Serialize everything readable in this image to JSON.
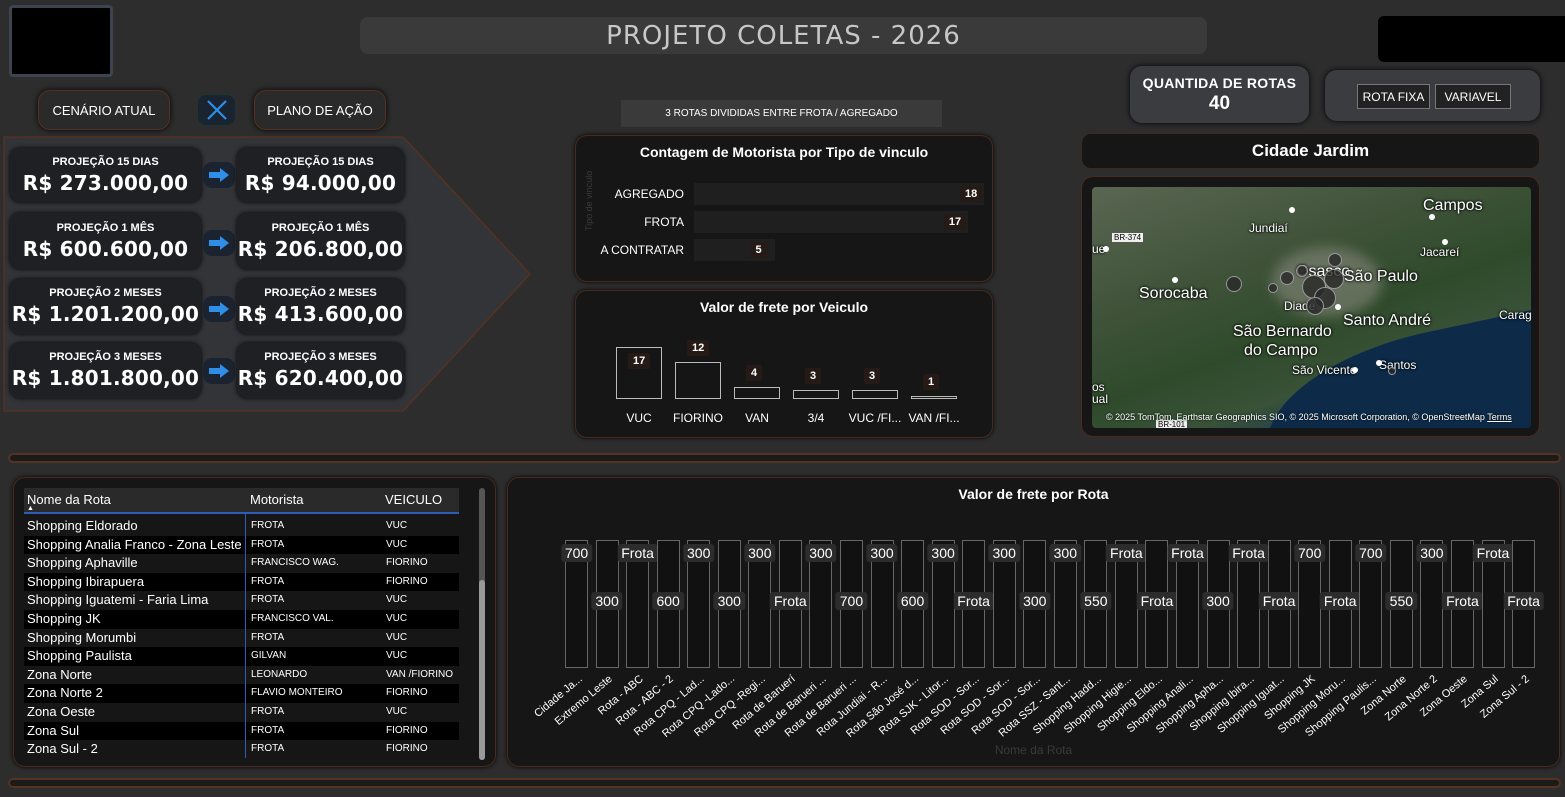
{
  "header": {
    "title": "PROJETO COLETAS - 2026",
    "scenario_current": "CENÁRIO ATUAL",
    "scenario_plan": "PLANO DE AÇÃO",
    "banner": "3 ROTAS DIVIDIDAS  ENTRE  FROTA / AGREGADO"
  },
  "qtd": {
    "label": "QUANTIDA DE ROTAS",
    "value": "40"
  },
  "segment": {
    "fixed": "ROTA FIXA",
    "variable": "VARIAVEL"
  },
  "projections": [
    {
      "label": "PROJEÇÃO 15 DIAS",
      "current": "R$ 273.000,00",
      "plan_label": "PROJEÇÃO 15 DIAS",
      "plan": "R$ 94.000,00"
    },
    {
      "label": "PROJEÇÃO 1 MÊS",
      "current": "R$ 600.600,00",
      "plan_label": "PROJEÇÃO 1 MÊS",
      "plan": "R$ 206.800,00"
    },
    {
      "label": "PROJEÇÃO 2 MESES",
      "current": "R$ 1.201.200,00",
      "plan_label": "PROJEÇÃO 2 MESES",
      "plan": "R$ 413.600,00"
    },
    {
      "label": "PROJEÇÃO 3 MESES",
      "current": "R$ 1.801.800,00",
      "plan_label": "PROJEÇÃO 3 MESES",
      "plan": "R$ 620.400,00"
    }
  ],
  "colors": {
    "accent_border": "#553222",
    "blue": "#2c5db8",
    "panel": "#161616"
  },
  "chart_data": [
    {
      "type": "bar",
      "orientation": "horizontal",
      "title": "Contagem de Motorista por Tipo de vinculo",
      "ylabel": "Tipo de vinculo",
      "categories": [
        "AGREGADO",
        "FROTA",
        "A CONTRATAR"
      ],
      "values": [
        18,
        17,
        5
      ],
      "xlim": [
        0,
        18
      ]
    },
    {
      "type": "bar",
      "title": "Valor de frete por Veiculo",
      "categories": [
        "VUC",
        "FIORINO",
        "VAN",
        "3/4",
        "VUC /FI...",
        "VAN /FI..."
      ],
      "values": [
        17,
        12,
        4,
        3,
        3,
        1
      ],
      "ylim": [
        0,
        17
      ]
    },
    {
      "type": "bar",
      "title": "Valor de frete por Rota",
      "xlabel": "Nome da Rota",
      "categories": [
        "Cidade Ja...",
        "Extremo Leste",
        "Rota - ABC",
        "Rota - ABC - 2",
        "Rota CPQ - Lad...",
        "Rota CPQ -Lado...",
        "Rota CPQ -Regi...",
        "Rota de Baruerí",
        "Rota de Barueri ...",
        "Rota de Barueri ...",
        "Rota Jundiai - R...",
        "Rota São José d...",
        "Rota SJK - Litor...",
        "Rota SOD - Sor...",
        "Rota SOD - Sor...",
        "Rota SOD - Sor...",
        "Rota SSZ - Sant...",
        "Shopping Hadd...",
        "Shopping Higie...",
        "Shopping Eldo...",
        "Shopping Anali...",
        "Shopping Apha...",
        "Shopping Ibira...",
        "Shopping Iguat...",
        "Shopping JK",
        "Shopping Moru...",
        "Shopping Paulis...",
        "Zona Norte",
        "Zona Norte 2",
        "Zona Oeste",
        "Zona Sul",
        "Zona Sul - 2"
      ],
      "value_labels": [
        "700",
        "300",
        "Frota",
        "600",
        "300",
        "300",
        "300",
        "Frota",
        "300",
        "700",
        "300",
        "600",
        "300",
        "Frota",
        "300",
        "300",
        "300",
        "550",
        "Frota",
        "Frota",
        "Frota",
        "300",
        "Frota",
        "Frota",
        "700",
        "Frota",
        "700",
        "550",
        "300",
        "Frota",
        "Frota",
        "Frota"
      ]
    }
  ],
  "map": {
    "title": "Cidade Jardim",
    "road_1": "BR-374",
    "road_2": "BR-101",
    "cities": [
      "Campos",
      "Jundiaí",
      "Jacareí",
      "Osasco",
      "São Paulo",
      "Sorocaba",
      "Diade",
      "Santo André",
      "Caragu",
      "São Bernardo",
      "do Campo",
      "São Vicente",
      "Santos",
      "ue",
      "ual",
      "os"
    ],
    "attribution": "© 2025 TomTom, Earthstar Geographics SIO, © 2025 Microsoft Corporation, © OpenStreetMap",
    "terms": "Terms"
  },
  "table": {
    "headers": [
      "Nome da Rota",
      "Motorista",
      "VEICULO"
    ],
    "rows": [
      [
        "Shopping Eldorado",
        "FROTA",
        "VUC"
      ],
      [
        "Shopping Analia Franco - Zona Leste",
        "FROTA",
        "VUC"
      ],
      [
        "Shopping Aphaville",
        "FRANCISCO WAG.",
        "FIORINO"
      ],
      [
        "Shopping Ibirapuera",
        "FROTA",
        "FIORINO"
      ],
      [
        "Shopping Iguatemi - Faria Lima",
        "FROTA",
        "VUC"
      ],
      [
        "Shopping JK",
        "FRANCISCO VAL.",
        "VUC"
      ],
      [
        "Shopping Morumbi",
        "FROTA",
        "VUC"
      ],
      [
        "Shopping Paulista",
        "GILVAN",
        "VUC"
      ],
      [
        "Zona Norte",
        "LEONARDO",
        "VAN /FIORINO"
      ],
      [
        "Zona Norte 2",
        "FLAVIO MONTEIRO",
        "FIORINO"
      ],
      [
        "Zona Oeste",
        "FROTA",
        "VUC"
      ],
      [
        "Zona Sul",
        "FROTA",
        "FIORINO"
      ],
      [
        "Zona Sul - 2",
        "FROTA",
        "FIORINO"
      ]
    ]
  }
}
